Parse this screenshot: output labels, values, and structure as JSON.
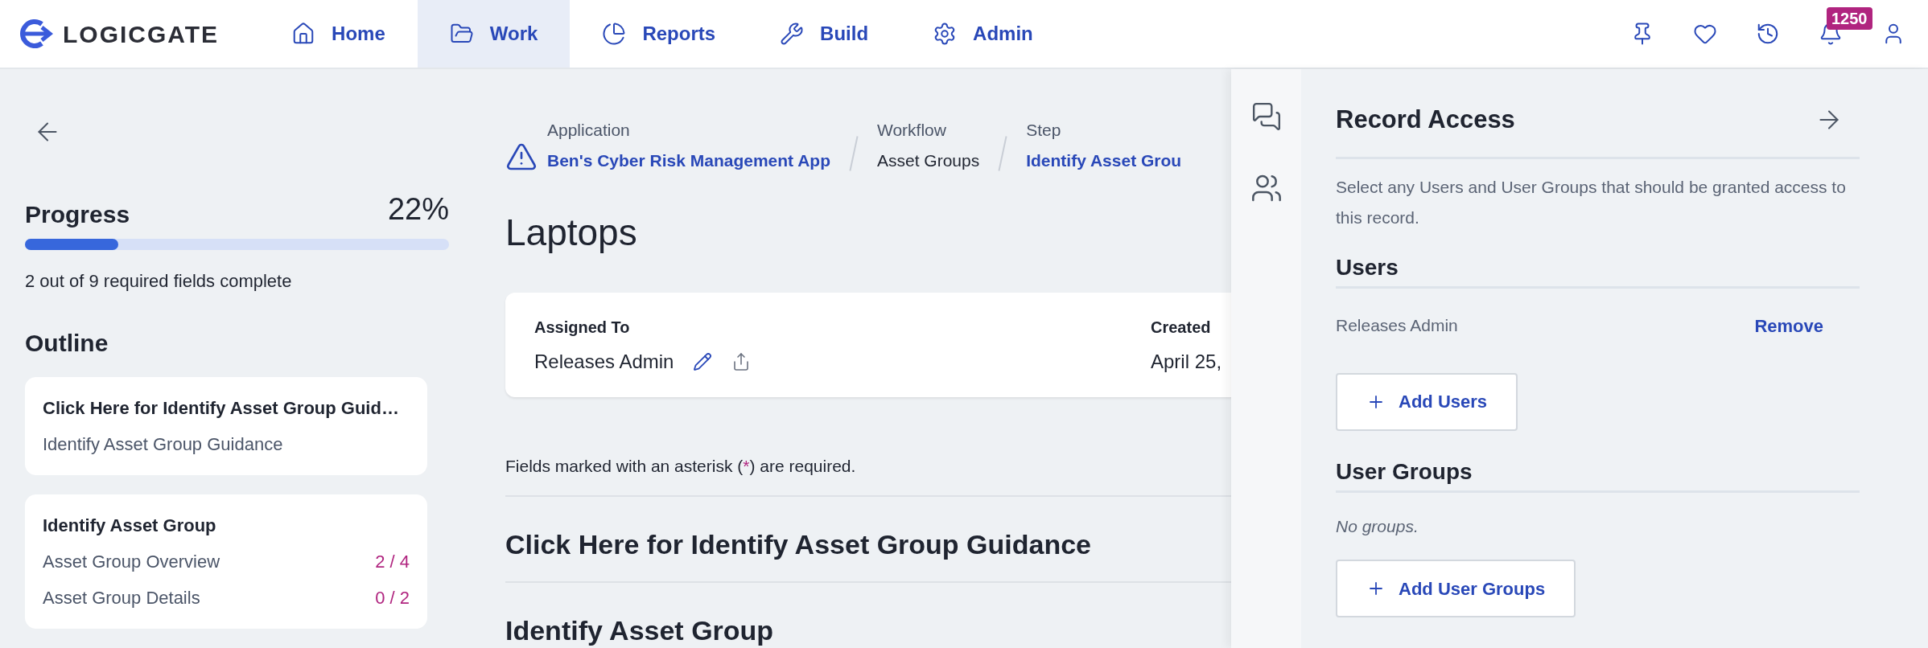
{
  "logo": {
    "text": "LOGICGATE"
  },
  "nav": [
    {
      "label": "Home",
      "selected": false
    },
    {
      "label": "Work",
      "selected": true
    },
    {
      "label": "Reports",
      "selected": false
    },
    {
      "label": "Build",
      "selected": false
    },
    {
      "label": "Admin",
      "selected": false
    }
  ],
  "notifications_badge": "1250",
  "progress": {
    "title": "Progress",
    "percent": "22%",
    "level": 0.22,
    "summary": "2 out of 9 required fields complete"
  },
  "outline": {
    "title": "Outline",
    "cards": [
      {
        "title": "Click Here for Identify Asset Group Guid…",
        "items": [
          {
            "label": "Identify Asset Group Guidance"
          }
        ]
      },
      {
        "title": "Identify Asset Group",
        "items": [
          {
            "label": "Asset Group Overview",
            "count": "2 / 4"
          },
          {
            "label": "Asset Group Details",
            "count": "0 / 2"
          }
        ]
      }
    ]
  },
  "breadcrumbs": [
    {
      "label": "Application",
      "value": "Ben's Cyber Risk Management App",
      "kind": "link"
    },
    {
      "label": "Workflow",
      "value": "Asset Groups",
      "kind": "text"
    },
    {
      "label": "Step",
      "value": "Identify Asset Grou",
      "kind": "link"
    }
  ],
  "record_title": "Laptops",
  "info_card": {
    "fields": [
      {
        "label": "Assigned To",
        "value": "Releases Admin",
        "editable": true
      },
      {
        "label": "Created",
        "value": "April 25,",
        "editable": false
      }
    ]
  },
  "required_note": {
    "before": "Fields marked with an asterisk (",
    "mark": "*",
    "after": ") are required."
  },
  "sections": [
    "Click Here for Identify Asset Group Guidance",
    "Identify Asset Group"
  ],
  "record_access": {
    "title": "Record Access",
    "description": "Select any Users and User Groups that should be granted access to this record.",
    "users_title": "Users",
    "users": [
      {
        "name": "Releases Admin",
        "action": "Remove"
      }
    ],
    "add_users": "Add Users",
    "groups_title": "User Groups",
    "groups_empty": "No groups.",
    "add_groups": "Add User Groups"
  }
}
